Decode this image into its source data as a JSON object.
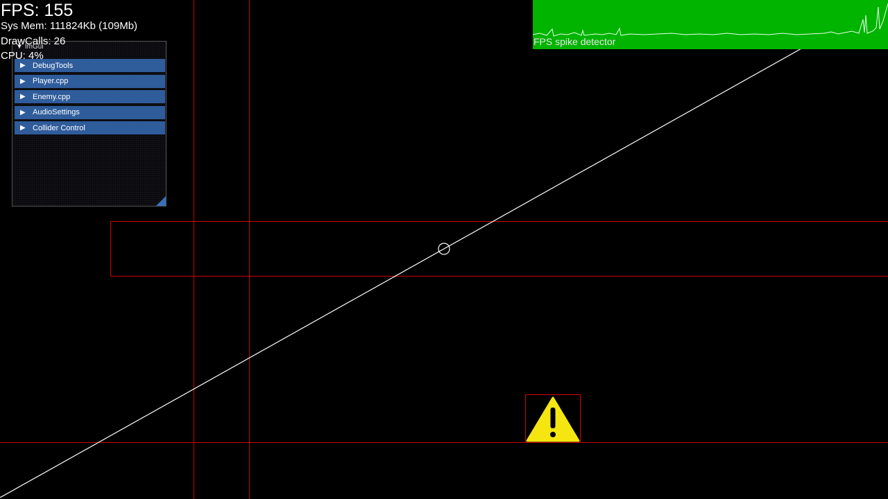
{
  "hud": {
    "fps": "FPS: 155",
    "sys_mem": "Sys Mem: 111824Kb (109Mb)",
    "draw_calls": "DrawCalls: 26",
    "cpu": "CPU: 4%"
  },
  "imgui": {
    "title": "ImGui",
    "items": [
      {
        "label": "DebugTools"
      },
      {
        "label": "Player.cpp"
      },
      {
        "label": "Enemy.cpp"
      },
      {
        "label": "AudioSettings"
      },
      {
        "label": "Collider Control"
      }
    ]
  },
  "fps_graph": {
    "label": "FPS spike detector",
    "background_color": "#00b400"
  },
  "colors": {
    "collider": "#d00000",
    "ray": "#ffffff",
    "warning": "#f5e612"
  },
  "icons": {
    "warning": "warning-triangle-icon",
    "cursor": "crosshair-circle-icon"
  }
}
